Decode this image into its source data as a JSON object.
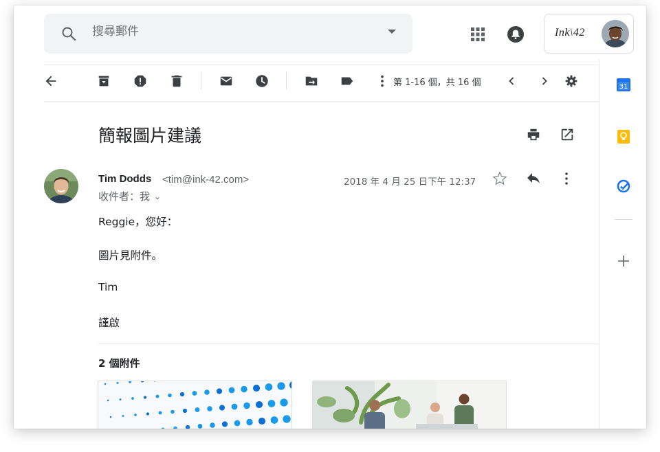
{
  "search": {
    "placeholder": "搜尋郵件"
  },
  "account": {
    "brand": "Ink\\42"
  },
  "toolbar": {
    "pager": "第 1-16 個，共 16 個"
  },
  "message": {
    "subject": "簡報圖片建議",
    "sender_name": "Tim Dodds",
    "sender_email": "<tim@ink-42.com>",
    "recipients": "收件者：我",
    "date": "2018 年 4 月 25 日下午 12:37",
    "body": [
      "Reggie，您好：",
      "圖片見附件。",
      "Tim",
      "謹啟"
    ]
  },
  "attachments": {
    "title": "2 個附件"
  },
  "sidepanel": {
    "calendar_day": "31"
  },
  "colors": {
    "accent_blue": "#1a73e8",
    "keep_yellow": "#fbbc04",
    "icon_gray": "#5f6368"
  },
  "icons": [
    "search-icon",
    "dropdown-icon",
    "apps-icon",
    "notifications-icon",
    "back-arrow-icon",
    "archive-icon",
    "report-spam-icon",
    "delete-icon",
    "mark-unread-icon",
    "snooze-icon",
    "move-to-icon",
    "label-icon",
    "more-vert-icon",
    "chevron-left-icon",
    "chevron-right-icon",
    "settings-icon",
    "print-icon",
    "open-in-new-icon",
    "star-icon",
    "reply-icon",
    "calendar-icon",
    "keep-icon",
    "tasks-icon",
    "add-icon"
  ]
}
